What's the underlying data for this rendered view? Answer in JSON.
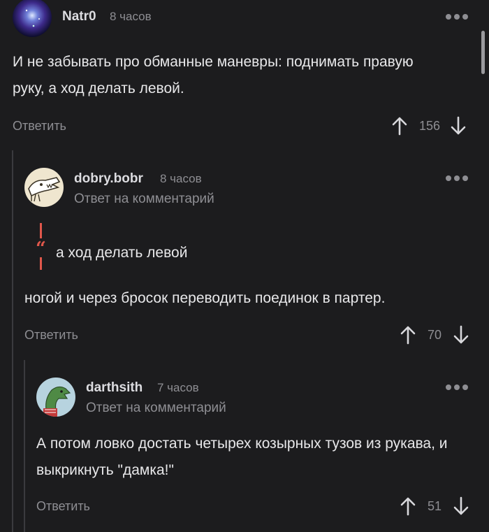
{
  "comments": [
    {
      "author": "Natr0",
      "time": "8 часов",
      "subtitle": "",
      "text": "И не забывать про обманные маневры: поднимать правую руку, а ход делать левой.",
      "reply_label": "Ответить",
      "votes": "156"
    },
    {
      "author": "dobry.bobr",
      "time": "8 часов",
      "subtitle": "Ответ на комментарий",
      "quote": "а ход делать левой",
      "quote_mark": "“",
      "text": "ногой и через бросок переводить поединок в партер.",
      "reply_label": "Ответить",
      "votes": "70"
    },
    {
      "author": "darthsith",
      "time": "7 часов",
      "subtitle": "Ответ на комментарий",
      "text": "А потом ловко достать четырех козырных тузов из рукава, и выкрикнуть \"дамка!\"",
      "reply_label": "Ответить",
      "votes": "51"
    }
  ],
  "icons": {
    "more": "more-dots-icon",
    "upvote": "arrow-up-icon",
    "downvote": "arrow-down-icon"
  },
  "colors": {
    "background": "#1c1c1e",
    "quote_accent": "#e0574b",
    "muted": "#8e8e93"
  }
}
